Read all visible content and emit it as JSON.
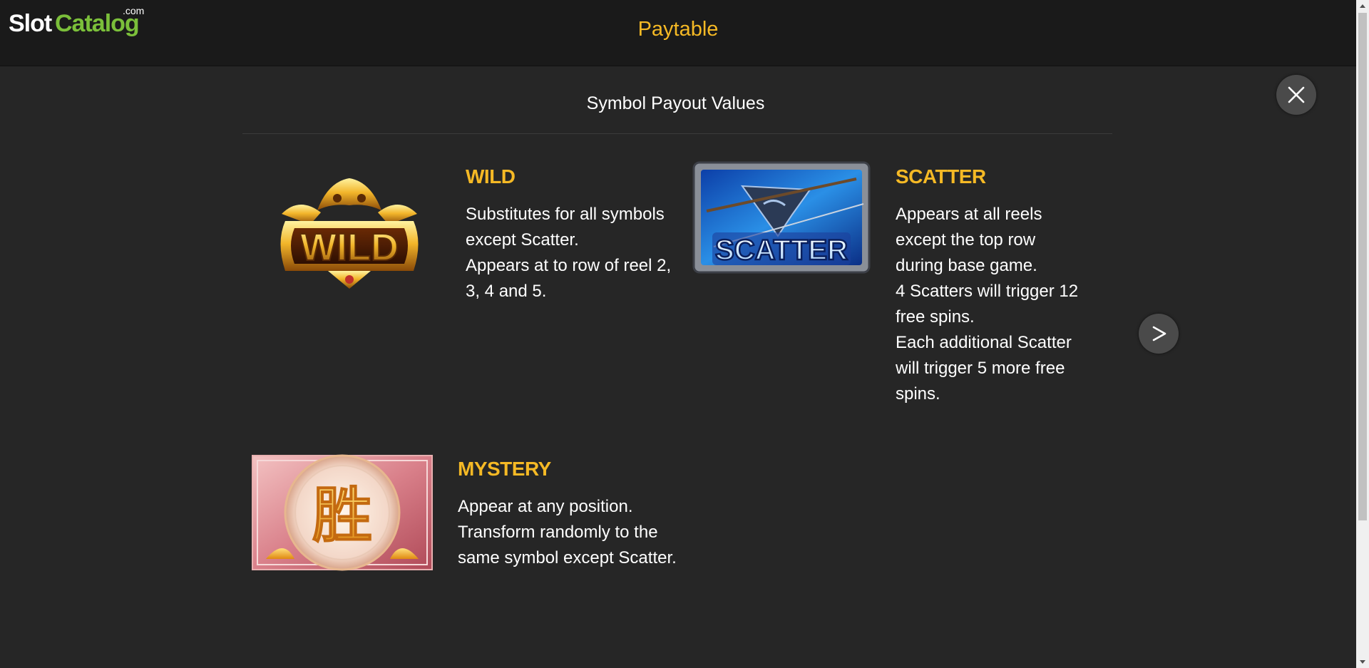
{
  "header": {
    "logo_slot": "Slot",
    "logo_catalog": "Catalog",
    "logo_dotcom": ".com",
    "title": "Paytable"
  },
  "section_title": "Symbol Payout Values",
  "symbols": {
    "wild": {
      "name": "WILD",
      "badge": "WILD",
      "lines": [
        "Substitutes for all symbols",
        "except Scatter.",
        "Appears at to row of reel 2,",
        "3, 4 and 5."
      ]
    },
    "scatter": {
      "name": "SCATTER",
      "badge": "SCATTER",
      "lines": [
        "Appears at all reels",
        "except the top row",
        "during base game.",
        "4 Scatters will trigger 12",
        "free spins.",
        "Each additional Scatter",
        "will trigger 5 more free",
        "spins."
      ]
    },
    "mystery": {
      "name": "MYSTERY",
      "glyph": "胜",
      "lines": [
        "Appear at any position.",
        "Transform randomly to the",
        "same symbol except Scatter."
      ]
    }
  },
  "icons": {
    "close": "close-icon",
    "next": "chevron-right-icon"
  },
  "colors": {
    "accent": "#f5b925",
    "background": "#262626",
    "topbar": "#1a1a1a",
    "logo_green": "#7bbf3a"
  }
}
